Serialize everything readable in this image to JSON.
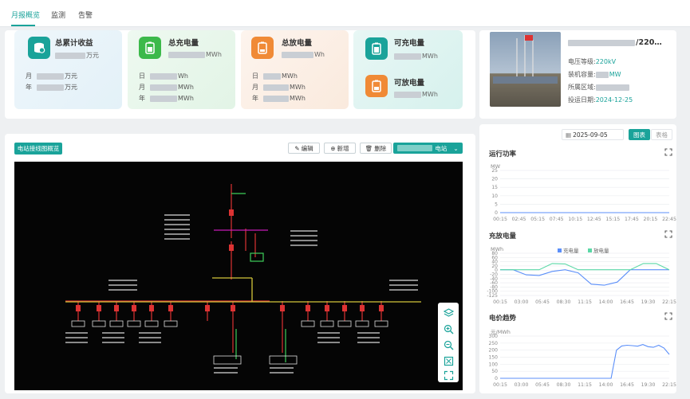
{
  "tabs": [
    {
      "label": "月报概览",
      "active": true
    },
    {
      "label": "监测",
      "active": false
    },
    {
      "label": "告警",
      "active": false
    }
  ],
  "cards": {
    "revenue": {
      "title": "总累计收益",
      "unit": "万元",
      "rows": [
        {
          "k": "月",
          "unit": "万元"
        },
        {
          "k": "年",
          "unit": "万元"
        }
      ]
    },
    "charge": {
      "title": "总充电量",
      "unit": "MWh",
      "rows": [
        {
          "k": "日",
          "unit": "Wh"
        },
        {
          "k": "月",
          "unit": "MWh"
        },
        {
          "k": "年",
          "unit": "MWh"
        }
      ]
    },
    "discharge": {
      "title": "总放电量",
      "unit": "Wh",
      "rows": [
        {
          "k": "日",
          "unit": "MWh"
        },
        {
          "k": "月",
          "unit": "MWh"
        },
        {
          "k": "年",
          "unit": "MWh"
        }
      ]
    },
    "chargeable": {
      "title": "可充电量",
      "unit": "MWh"
    },
    "dischargeable": {
      "title": "可放电量",
      "unit": "MWh"
    }
  },
  "station": {
    "name_suffix": "/220…",
    "voltage_label": "电压等级:",
    "voltage_value": "220kV",
    "capacity_label": "装机容量:",
    "capacity_value": "MW",
    "region_label": "所属区域:",
    "date_label": "投运日期:",
    "date_value": "2024-12-25"
  },
  "toolbar": {
    "overview": "电站接线图概览",
    "edit": "编辑",
    "add": "新增",
    "delete": "删除",
    "station": "电站"
  },
  "right": {
    "date": "2025-09-05",
    "view_chart": "图表",
    "view_table": "表格"
  },
  "chart_data": [
    {
      "type": "line",
      "title": "运行功率",
      "ylabel": "MW",
      "y_ticks": [
        "25",
        "20",
        "15",
        "10",
        "5",
        "0"
      ],
      "ylim": [
        0,
        25
      ],
      "x": [
        "00:15",
        "02:45",
        "05:15",
        "07:45",
        "10:15",
        "12:45",
        "15:15",
        "17:45",
        "20:15",
        "22:45"
      ],
      "series": [
        {
          "values": [
            0,
            0,
            0,
            0,
            0,
            0,
            0,
            0,
            0,
            0
          ]
        }
      ],
      "grid": true
    },
    {
      "type": "line",
      "title": "充放电量",
      "ylabel": "MWh",
      "y_ticks": [
        "80",
        "60",
        "40",
        "20",
        "0",
        "-20",
        "-40",
        "-60",
        "-80",
        "-100",
        "-125"
      ],
      "ylim": [
        -125,
        80
      ],
      "x": [
        "00:15",
        "03:00",
        "05:45",
        "08:30",
        "11:15",
        "14:00",
        "16:45",
        "19:30",
        "22:15"
      ],
      "legend": "top-center",
      "series": [
        {
          "name": "充电量",
          "color": "#5b8ff9",
          "values": [
            0,
            0,
            -25,
            -28,
            -8,
            0,
            -15,
            -70,
            -75,
            -60,
            0,
            0,
            0,
            0
          ]
        },
        {
          "name": "放电量",
          "color": "#5ad8a6",
          "values": [
            0,
            0,
            0,
            0,
            30,
            28,
            0,
            0,
            0,
            0,
            0,
            30,
            30,
            0
          ]
        }
      ],
      "grid": true
    },
    {
      "type": "line",
      "title": "电价趋势",
      "ylabel": "元/MWh",
      "y_ticks": [
        "300",
        "250",
        "200",
        "150",
        "100",
        "50",
        "0"
      ],
      "ylim": [
        0,
        300
      ],
      "x": [
        "00:15",
        "03:00",
        "05:45",
        "08:30",
        "11:15",
        "14:00",
        "16:45",
        "19:30",
        "22:15"
      ],
      "series": [
        {
          "color": "#5b8ff9",
          "values": [
            0,
            0,
            0,
            0,
            0,
            0,
            0,
            0,
            0,
            0,
            0,
            0,
            0,
            0,
            0,
            0,
            0,
            0,
            0,
            0,
            0,
            0,
            200,
            230,
            235,
            232,
            228,
            240,
            225,
            220,
            235,
            215,
            170
          ]
        }
      ],
      "grid": true
    }
  ]
}
